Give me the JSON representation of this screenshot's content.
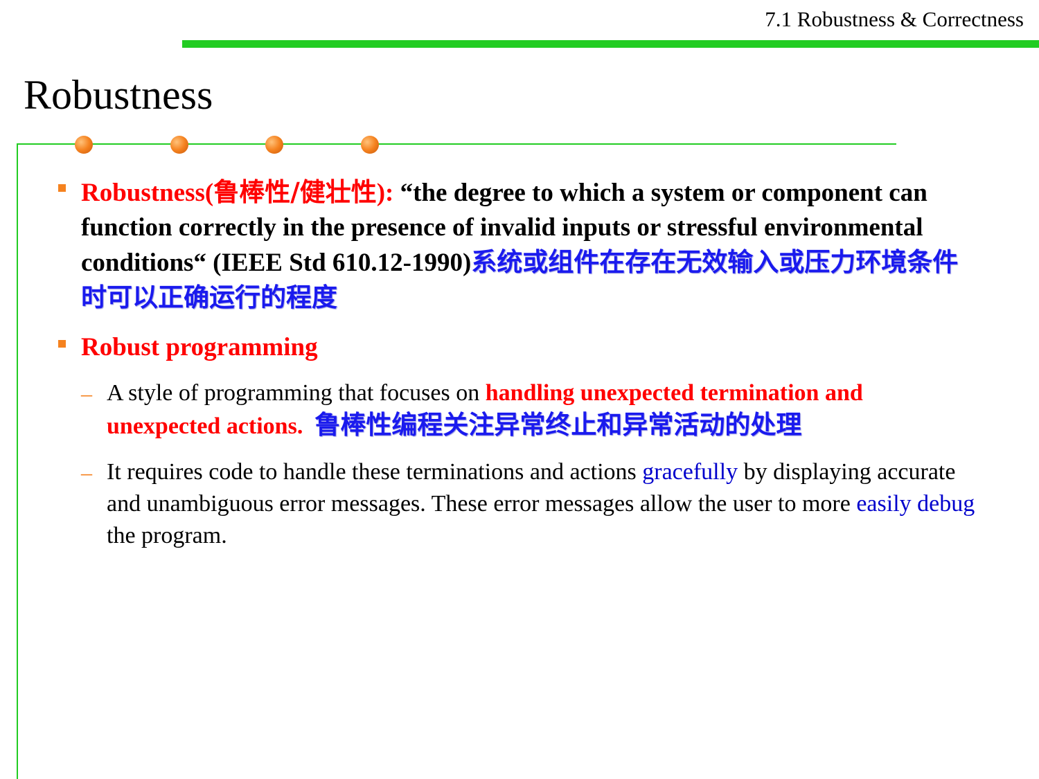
{
  "header": {
    "section_title": "7.1 Robustness & Correctness"
  },
  "slide": {
    "title": "Robustness"
  },
  "colors": {
    "accent_green": "#22cc22",
    "bullet_orange": "#f5821f",
    "term_red": "#ff0000",
    "chinese_blue": "#1a1aee"
  },
  "bullets": [
    {
      "term": "Robustness(",
      "term_cn": "鲁棒性/健壮性",
      "term_close": "):",
      "quote": " “the degree to which a system or component can function correctly in the presence of invalid inputs or stressful environmental conditions“ (IEEE Std 610.12-1990)",
      "translation": "系统或组件在存在无效输入或压力环境条件时可以正确运行的程度"
    },
    {
      "term": "Robust programming",
      "subitems": [
        {
          "dash": "–",
          "text_a": "A style of programming that focuses on ",
          "highlight": "handling unexpected termination and unexpected actions.",
          "translation": "鲁棒性编程关注异常终止和异常活动的处理"
        },
        {
          "dash": "–",
          "text_a": "It requires code to handle these terminations and actions ",
          "link1": "gracefully",
          "text_b": " by displaying accurate and unambiguous error messages. These error messages allow the user to more ",
          "link2": "easily debug",
          "text_c": " the program."
        }
      ]
    }
  ]
}
